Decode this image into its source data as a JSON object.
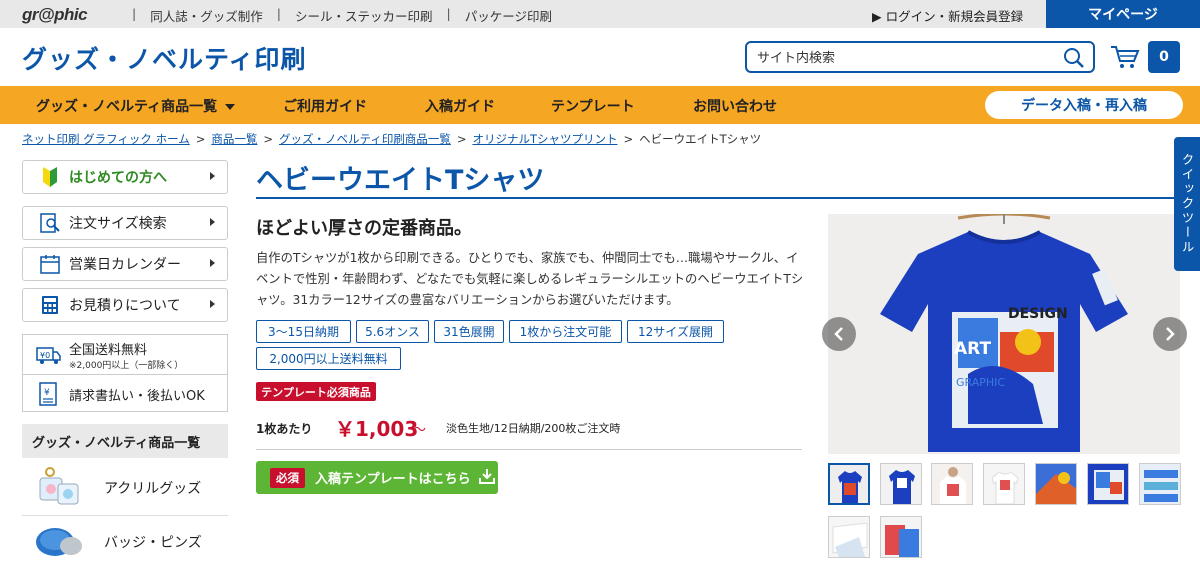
{
  "topbar": {
    "logo": "gr@phic",
    "links": [
      "同人誌・グッズ制作",
      "シール・ステッカー印刷",
      "パッケージ印刷"
    ],
    "login": "▶ ログイン・新規会員登録",
    "mypage": "マイページ"
  },
  "header": {
    "title": "グッズ・ノベルティ印刷",
    "search_placeholder": "サイト内検索",
    "cart_count": "0"
  },
  "nav": {
    "items": [
      "グッズ・ノベルティ商品一覧",
      "ご利用ガイド",
      "入稿ガイド",
      "テンプレート",
      "お問い合わせ"
    ],
    "data_entry": "データ入稿・再入稿"
  },
  "breadcrumb": {
    "links": [
      "ネット印刷 グラフィック ホーム",
      "商品一覧",
      "グッズ・ノベルティ印刷商品一覧",
      "オリジナルTシャツプリント"
    ],
    "current": "ヘビーウエイトTシャツ"
  },
  "sidebar": {
    "buttons": [
      "はじめての方へ",
      "注文サイズ検索",
      "営業日カレンダー",
      "お見積りについて"
    ],
    "shipping_title": "全国送料無料",
    "shipping_note": "※2,000円以上（一部除く）",
    "payment": "請求書払い・後払いOK",
    "category_header": "グッズ・ノベルティ商品一覧",
    "categories": [
      "アクリルグッズ",
      "バッジ・ピンズ"
    ]
  },
  "product": {
    "title": "ヘビーウエイトTシャツ",
    "subtitle": "ほどよい厚さの定番商品。",
    "description": "自作のTシャツが1枚から印刷できる。ひとりでも、家族でも、仲間同士でも…職場やサークル、イベントで性別・年齢問わず、どなたでも気軽に楽しめるレギュラーシルエットのヘビーウエイトTシャツ。31カラー12サイズの豊富なバリエーションからお選びいただけます。",
    "tags": [
      "3〜15日納期",
      "5.6オンス",
      "31色展開",
      "1枚から注文可能",
      "12サイズ展開",
      "2,000円以上送料無料"
    ],
    "template_badge": "テンプレート必須商品",
    "price_label": "1枚あたり",
    "price": "￥1,003",
    "price_suffix": "～",
    "price_note": "淡色生地/12日納期/200枚ご注文時",
    "must_label": "必須",
    "download_label": "入稿テンプレートはこちら"
  },
  "gallery": {
    "shirt_print_text_1": "DESIGN",
    "shirt_print_text_2": "ART",
    "shirt_print_text_3": "GRAPHIC",
    "thumbnails": 9
  },
  "quick_tool": "クイックツール",
  "colors": {
    "brand_blue": "#0b56a8",
    "nav_orange": "#f5a623",
    "accent_red": "#c8102e",
    "button_green": "#5cb534"
  }
}
